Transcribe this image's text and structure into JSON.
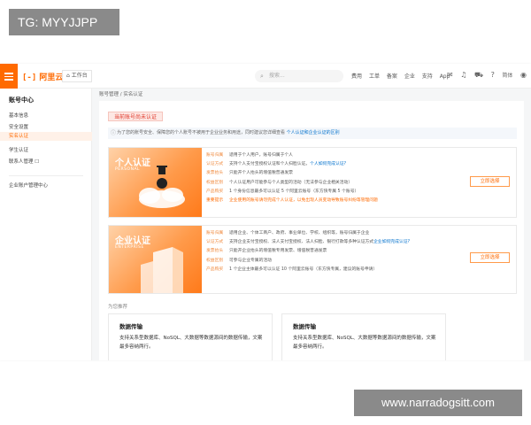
{
  "watermarks": {
    "top": "TG: MYYJJPP",
    "bottom": "www.narradogsitt.com"
  },
  "header": {
    "logo_bracket": "[-]",
    "logo_text": "阿里云",
    "workbench_label": "工作台",
    "search_placeholder": "搜索...",
    "nav_links": [
      "费用",
      "工单",
      "备案",
      "企业",
      "支持",
      "App"
    ],
    "lang_label": "简体"
  },
  "sidebar": {
    "title": "账号中心",
    "items": [
      {
        "label": "基本信息",
        "active": false
      },
      {
        "label": "安全设置",
        "active": false
      },
      {
        "label": "实名认证",
        "active": true
      },
      {
        "label": "学生认证",
        "active": false
      },
      {
        "label": "联系人管理 ☐",
        "active": false
      },
      {
        "label": "企业账户管理中心",
        "active": false
      }
    ]
  },
  "breadcrumb": {
    "root": "账号管理",
    "sep": "/",
    "current": "实名认证"
  },
  "status_tag": "当前账号尚未认证",
  "notice": {
    "text": "为了您的账号安全、保障您的个人账号不被用于企业业务和用途，同时建议您详细查看 ",
    "link": "个人认证和企业认证的区别"
  },
  "personal": {
    "title": "个人认证",
    "subtitle": "PERSONAL",
    "rows": [
      {
        "k": "账号归属",
        "v": "适用于个人用户，账号归属于个人"
      },
      {
        "k": "认证方式",
        "v": "支持个人支付宝授权认证和个人扫脸认证。",
        "link": "个人如何完成认证?"
      },
      {
        "k": "发票抬头",
        "v": "只能开个人抬头的增值税普通发票"
      },
      {
        "k": "权益区别",
        "v": "个人认证用户可能参与个人类型的活动（无法参与企业相关活动）"
      },
      {
        "k": "产品购买",
        "v": "1 个身份信息最多可以认证 5 个阿里云账号（东方快专属 5 个账号）"
      }
    ],
    "warn": {
      "k": "重要提示",
      "v": "企业使用的账号请勿完成个人认证，以免出现人员变动导致账号纠纷等管理问题"
    },
    "button": "立即选择"
  },
  "enterprise": {
    "title": "企业认证",
    "subtitle": "ENTERPRISE",
    "rows": [
      {
        "k": "账号归属",
        "v": "适用企业、个体工商户、政府、事业单位、学校、组织等，账号归属于企业"
      },
      {
        "k": "认证方式",
        "v": "支持企业支付宝授权、法人支付宝授权、法人扫脸、银行打款等多种认证方式",
        "link": "企业如何完成认证?"
      },
      {
        "k": "发票抬头",
        "v": "只能开企业抬头的增值税专用发票、增值税普通发票"
      },
      {
        "k": "权益区别",
        "v": "可参与企业专属的活动"
      },
      {
        "k": "产品购买",
        "v": "1 个企业主体最多可以认证 10 个阿里云账号（东方快专属，建议的账号申请）"
      }
    ],
    "button": "立即选择"
  },
  "recommend": {
    "title": "为您推荐",
    "cards": [
      {
        "title": "数据传输",
        "desc": "支持关系型数据库、NoSQL、大数据等数据源间的数据传输，文案最多容纳两行。"
      },
      {
        "title": "数据传输",
        "desc": "支持关系型数据库、NoSQL、大数据等数据源间的数据传输，文案最多容纳两行。"
      }
    ]
  },
  "colors": {
    "accent": "#ff6a00",
    "link": "#0070cc",
    "warn_bg": "#fde8e4"
  }
}
